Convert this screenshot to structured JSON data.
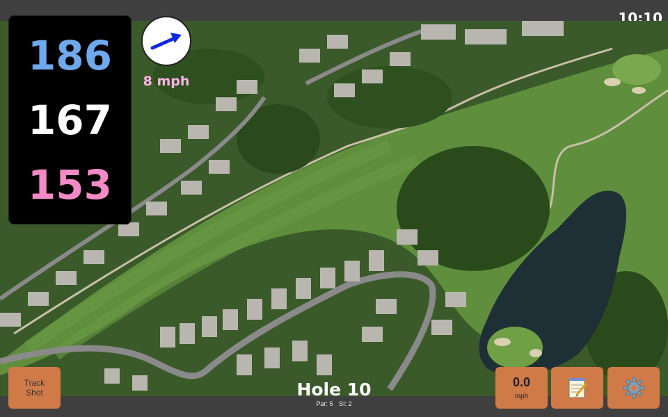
{
  "status": {
    "time": "10:10"
  },
  "distances": {
    "back": "186",
    "center": "167",
    "front": "153"
  },
  "wind": {
    "speed_label": "8 mph",
    "direction_icon": "arrow-icon"
  },
  "buttons": {
    "track_shot": "Track\nShot",
    "wind_value": "0.0",
    "wind_unit": "mph",
    "notes_icon": "notepad-icon",
    "settings_icon": "gear-icon"
  },
  "hole": {
    "title": "Hole 10",
    "par": "Par: 5",
    "si": "SI: 2"
  },
  "colors": {
    "back": "#6fa8ec",
    "center": "#ffffff",
    "front": "#f48ac5",
    "button": "#d07a48"
  }
}
